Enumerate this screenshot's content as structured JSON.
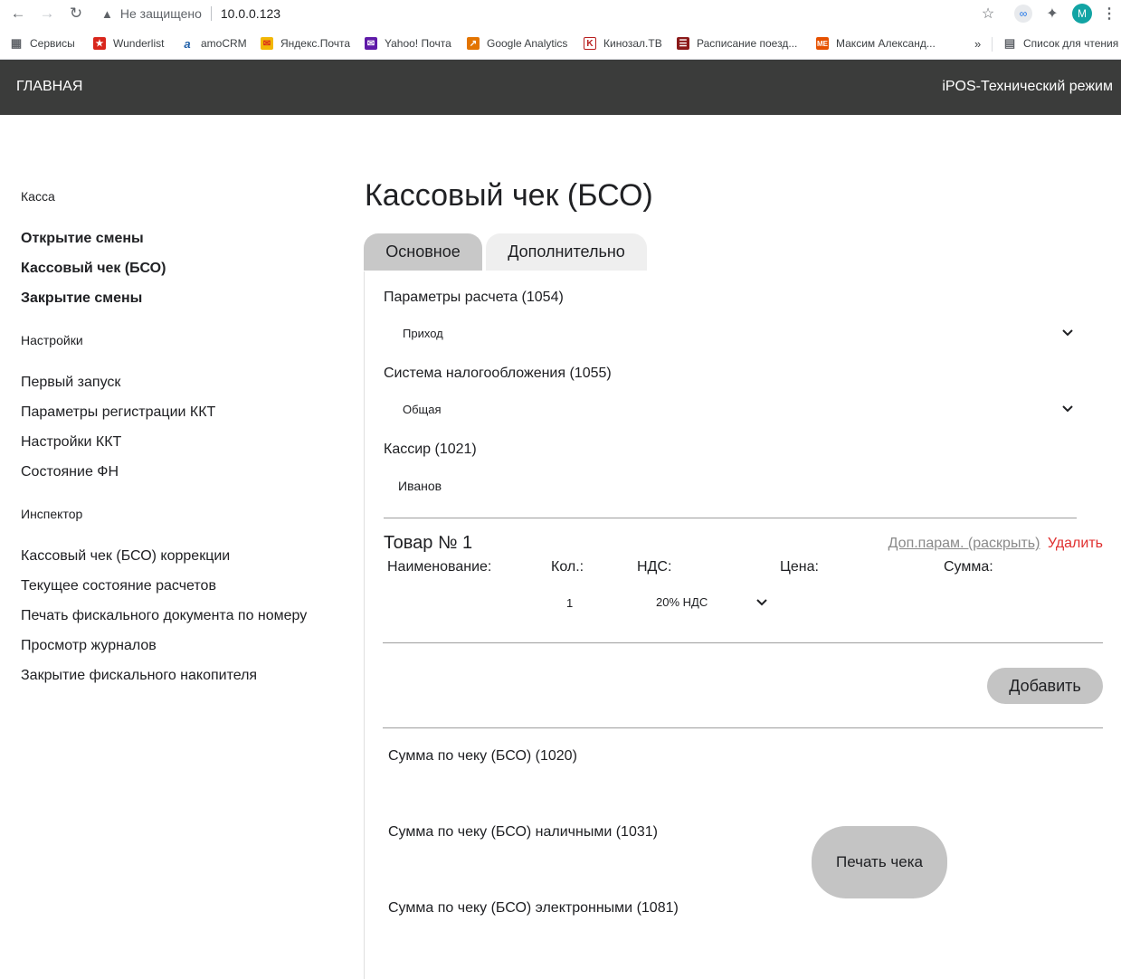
{
  "browser": {
    "security_text": "Не защищено",
    "url": "10.0.0.123",
    "avatar_letter": "M",
    "bookmarks": [
      {
        "label": "Сервисы",
        "icon": "apps-grid-icon"
      },
      {
        "label": "Wunderlist",
        "icon": "wunderlist-icon",
        "color": "#d9261c"
      },
      {
        "label": "amoCRM",
        "icon": "amocrm-icon",
        "color": "#1f5fa8"
      },
      {
        "label": "Яндекс.Почта",
        "icon": "yandex-mail-icon",
        "color": "#f2b705"
      },
      {
        "label": "Yahoo! Почта",
        "icon": "yahoo-mail-icon",
        "color": "#5f1aa8"
      },
      {
        "label": "Google Analytics",
        "icon": "google-analytics-icon",
        "color": "#e37400"
      },
      {
        "label": "Кинозал.ТВ",
        "icon": "kinozal-icon",
        "color": "#b71c1c"
      },
      {
        "label": "Расписание поезд...",
        "icon": "train-schedule-icon",
        "color": "#8b1a1a"
      },
      {
        "label": "Максим Александ...",
        "icon": "me-icon",
        "color": "#e65100"
      }
    ],
    "overflow": "»",
    "reading_list": "Список для чтения"
  },
  "header": {
    "home": "ГЛАВНАЯ",
    "mode": "iPOS-Технический режим"
  },
  "sidebar": {
    "sections": [
      {
        "title": "Касса",
        "items": [
          {
            "label": "Открытие смены",
            "bold": true
          },
          {
            "label": "Кассовый чек (БСО)",
            "bold": true
          },
          {
            "label": "Закрытие смены",
            "bold": true
          }
        ]
      },
      {
        "title": "Настройки",
        "items": [
          {
            "label": "Первый запуск"
          },
          {
            "label": "Параметры регистрации ККТ"
          },
          {
            "label": "Настройки ККТ"
          },
          {
            "label": "Состояние ФН"
          }
        ]
      },
      {
        "title": "Инспектор",
        "items": [
          {
            "label": "Кассовый чек (БСО) коррекции"
          },
          {
            "label": "Текущее состояние расчетов"
          },
          {
            "label": "Печать фискального документа по номеру"
          },
          {
            "label": "Просмотр журналов"
          },
          {
            "label": "Закрытие фискального накопителя"
          }
        ]
      }
    ]
  },
  "main": {
    "title": "Кассовый чек (БСО)",
    "tabs": [
      {
        "label": "Основное",
        "active": true
      },
      {
        "label": "Дополнительно",
        "active": false
      }
    ],
    "payment_params": {
      "label": "Параметры расчета (1054)",
      "value": "Приход"
    },
    "tax_system": {
      "label": "Система налогообложения (1055)",
      "value": "Общая"
    },
    "cashier": {
      "label": "Кассир (1021)",
      "value": "Иванов"
    },
    "item": {
      "title": "Товар № 1",
      "more_link": "Доп.парам. (раскрыть)",
      "delete_link": "Удалить",
      "col_name": "Наименование:",
      "col_qty": "Кол.:",
      "col_vat": "НДС:",
      "col_price": "Цена:",
      "col_sum": "Сумма:",
      "qty": "1",
      "vat": "20% НДС"
    },
    "add_button": "Добавить",
    "sum_total": "Сумма по чеку (БСО) (1020)",
    "sum_cash": "Сумма по чеку (БСО) наличными (1031)",
    "sum_electronic": "Сумма по чеку (БСО) электронными (1081)",
    "print_button": "Печать чека"
  }
}
